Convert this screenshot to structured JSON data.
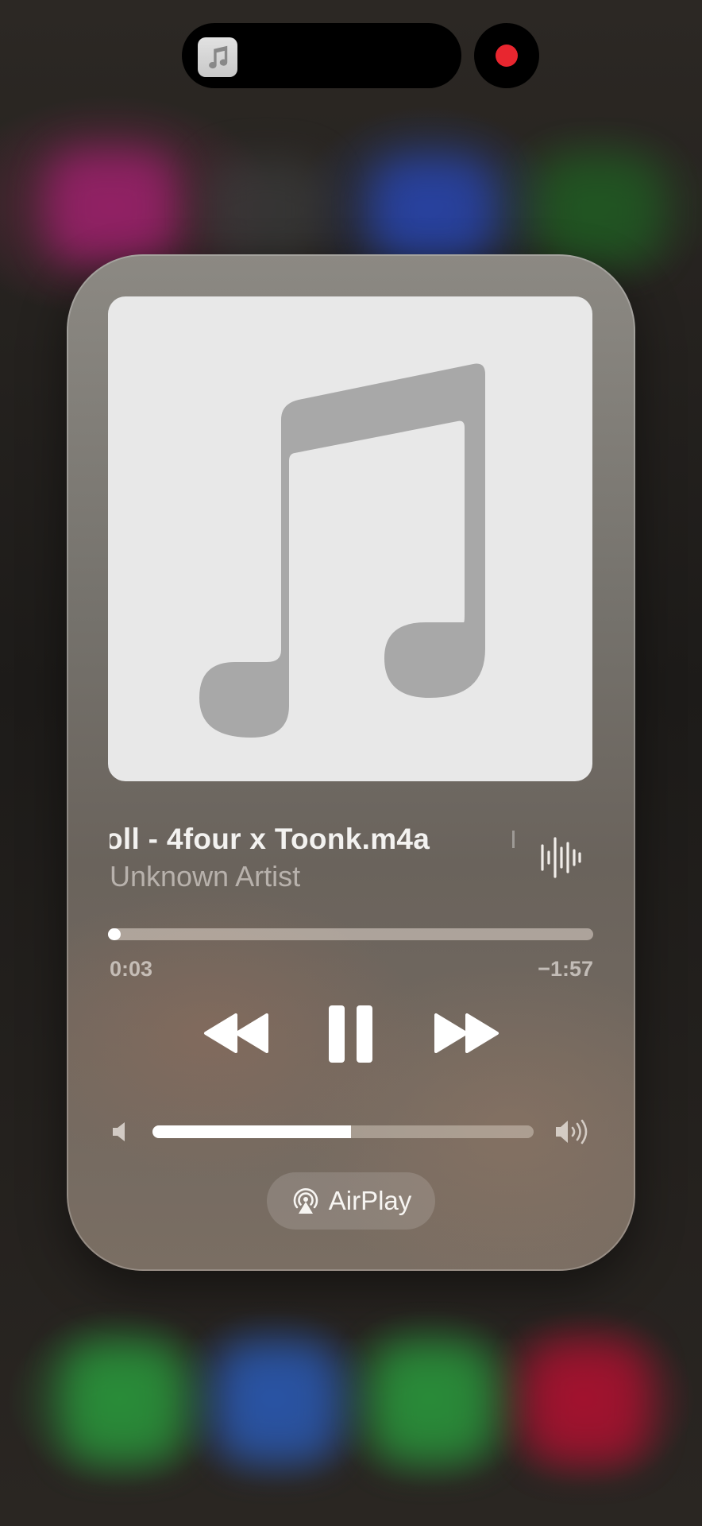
{
  "now_playing": {
    "title": "oll - 4four x Toonk.m4a",
    "artist": "Unknown Artist",
    "elapsed": "0:03",
    "remaining": "−1:57",
    "progress_fraction": 0.025,
    "volume_fraction": 0.52
  },
  "airplay": {
    "label": "AirPlay"
  },
  "colors": {
    "recording_dot": "#e8262f",
    "artwork_bg": "#e8e8e8",
    "artwork_glyph": "#a9a9a9"
  },
  "icons": {
    "island": "music-note-icon",
    "artwork": "music-note-icon",
    "waveform": "waveform-icon",
    "rewind": "rewind-icon",
    "pause": "pause-icon",
    "forward": "fast-forward-icon",
    "volume_low": "speaker-low-icon",
    "volume_high": "speaker-high-icon",
    "airplay": "airplay-icon"
  }
}
